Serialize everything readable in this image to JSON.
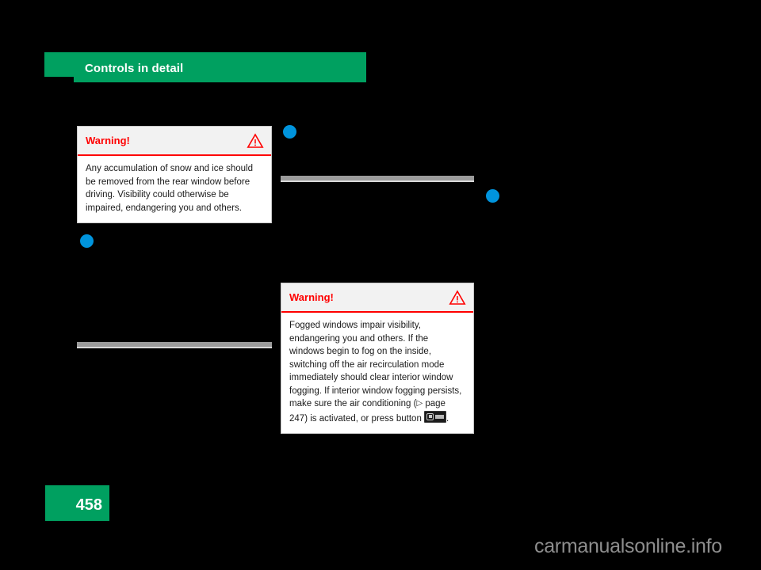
{
  "header": {
    "title": "Controls in detail"
  },
  "warnings": [
    {
      "title": "Warning!",
      "icon": "warning-triangle-icon",
      "body": "Any accumulation of snow and ice should be removed from the rear window before driving. Visibility could otherwise be impaired, endangering you and others."
    },
    {
      "title": "Warning!",
      "icon": "warning-triangle-icon",
      "body_part1": "Fogged windows impair visibility, endangering you and others. If the windows begin to fog on the inside, switching off the air recirculation mode immediately should clear interior window fogging. If interior window fogging persists, make sure the air conditioning (",
      "reference_symbol": "▷",
      "reference_text": " page 247",
      "body_part2": ") is activated, or press button ",
      "button_icon": "defrost-front-button-icon",
      "body_part3": "."
    }
  ],
  "markers": [
    {
      "name": "blue-bullet-marker-1"
    },
    {
      "name": "blue-bullet-marker-2"
    },
    {
      "name": "blue-bullet-marker-3"
    }
  ],
  "footer": {
    "page_number": "458",
    "watermark": "carmanualsonline.info"
  },
  "colors": {
    "brand_green": "#00A060",
    "warning_red": "#ff0000",
    "marker_blue": "#0094DD",
    "divider_gray": "#9b9b9b",
    "page_background": "#000000"
  }
}
